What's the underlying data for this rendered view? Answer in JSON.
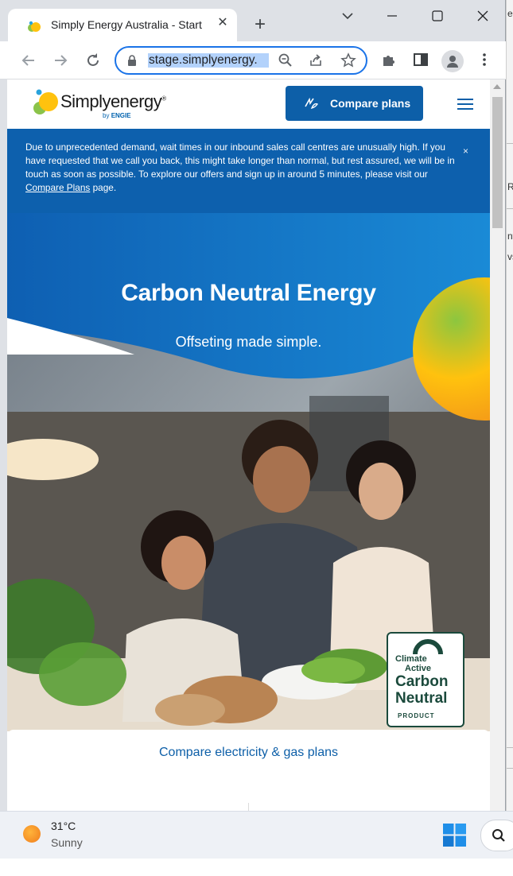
{
  "browser": {
    "tab_title": "Simply Energy Australia - Start",
    "url": "stage.simplyenergy.",
    "icons": [
      "back-icon",
      "forward-icon",
      "reload-icon",
      "lock-icon",
      "zoom-icon",
      "share-icon",
      "star-icon",
      "extensions-icon",
      "sidebar-icon",
      "profile-icon",
      "kebab-menu-icon",
      "minimize-icon",
      "maximize-icon",
      "close-icon",
      "tab-search-icon"
    ]
  },
  "background_window": {
    "fragments": [
      "ec",
      "R",
      "nte",
      "vs"
    ]
  },
  "site": {
    "logo_name": "Simplyenergy",
    "logo_registered": "®",
    "logo_by": "by",
    "logo_engie": "ENGIE",
    "cta_label": "Compare plans",
    "banner_text": "Due to unprecedented demand, wait times in our inbound sales call centres are unusually high. If you have requested that we call you back, this might take longer than normal, but rest assured, we will be in touch as soon as possible. To explore our offers and sign up in around 5 minutes, please visit our",
    "banner_link": "Compare Plans",
    "banner_tail": "page.",
    "banner_close": "×",
    "hero_title": "Carbon Neutral Energy",
    "hero_subtitle": "Offseting made simple.",
    "badge": {
      "line1": "Climate",
      "line2": "Active",
      "line3": "Carbon",
      "line4": "Neutral",
      "line5": "PRODUCT"
    },
    "compare_link": "Compare electricity & gas plans"
  },
  "taskbar": {
    "temperature": "31°C",
    "condition": "Sunny"
  },
  "colors": {
    "brand_blue": "#0d5fa8",
    "banner_blue": "#0d60ad",
    "focus_blue": "#1a73e8",
    "badge_green": "#1b4a3c"
  }
}
